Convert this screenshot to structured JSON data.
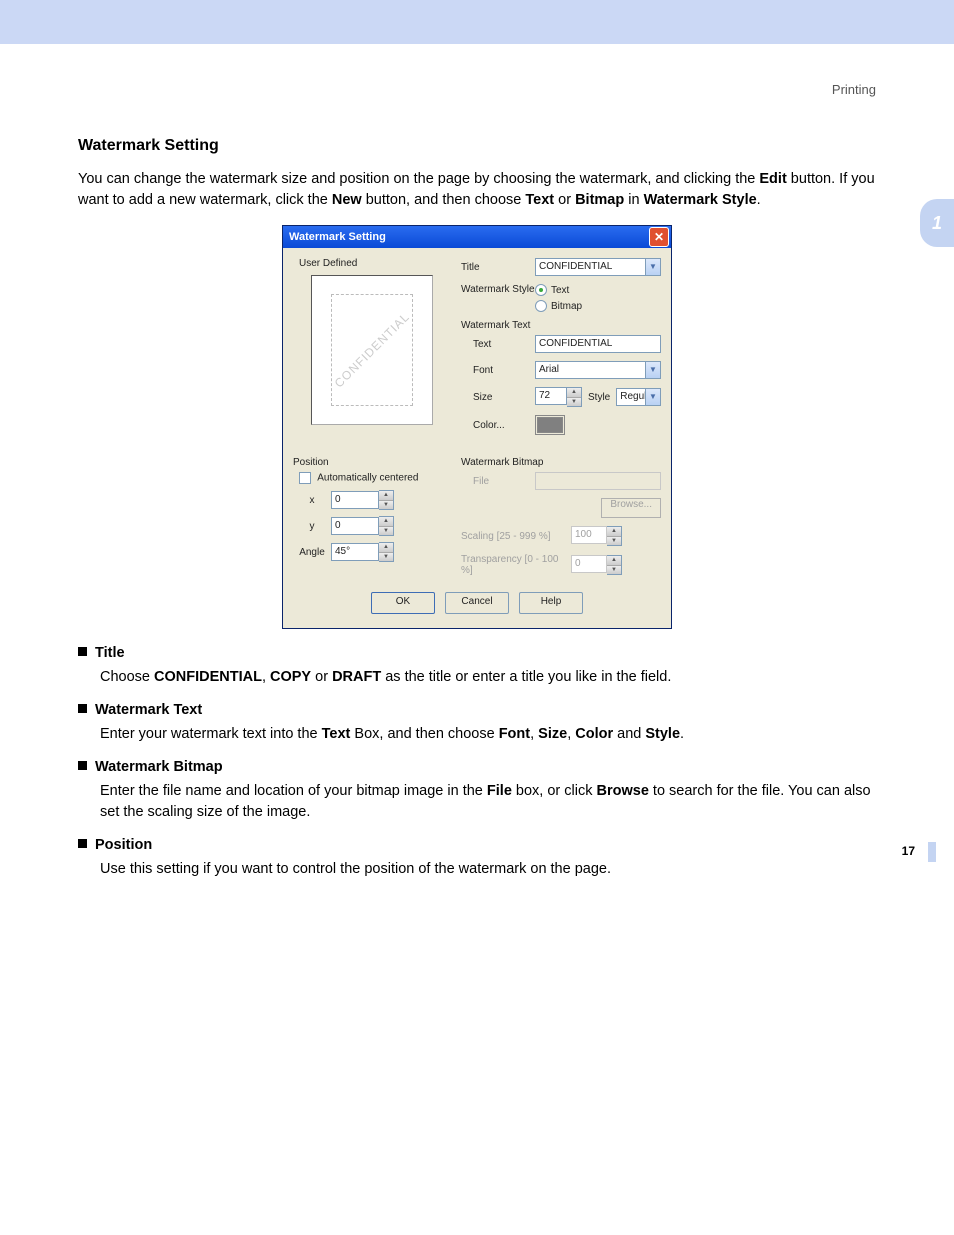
{
  "header": {
    "category": "Printing"
  },
  "section_tab": "1",
  "page_number": "17",
  "heading": "Watermark Setting",
  "intro": {
    "full": "You can change the watermark size and position on the page by choosing the watermark, and clicking the Edit button. If you want to add a new watermark, click the New button, and then choose Text or Bitmap in Watermark Style.",
    "part1": "You can change the watermark size and position on the page by choosing the watermark, and clicking the ",
    "b1": "Edit",
    "part2": " button. If you want to add a new watermark, click the ",
    "b2": "New",
    "part3": " button, and then choose ",
    "b3": "Text",
    "part4": " or ",
    "b4": "Bitmap",
    "part5": " in ",
    "b5": "Watermark Style",
    "part6": "."
  },
  "dialog": {
    "title": "Watermark Setting",
    "user_defined": "User Defined",
    "preview_watermark": "CONFIDENTIAL",
    "labels": {
      "title": "Title",
      "style": "Watermark Style",
      "style_text": "Text",
      "style_bitmap": "Bitmap",
      "wmtext": "Watermark Text",
      "text": "Text",
      "font": "Font",
      "size": "Size",
      "stylef": "Style",
      "color": "Color...",
      "position": "Position",
      "auto_center": "Automatically centered",
      "x": "x",
      "y": "y",
      "angle": "Angle",
      "wmbitmap": "Watermark Bitmap",
      "file": "File",
      "browse": "Browse...",
      "scaling": "Scaling [25 - 999 %]",
      "transparency": "Transparency [0 - 100 %]"
    },
    "values": {
      "title": "CONFIDENTIAL",
      "text": "CONFIDENTIAL",
      "font": "Arial",
      "size": "72",
      "stylef": "Regular",
      "x": "0",
      "y": "0",
      "angle": "45°",
      "scaling": "100",
      "transparency": "0"
    },
    "buttons": {
      "ok": "OK",
      "cancel": "Cancel",
      "help": "Help"
    }
  },
  "bullets": {
    "title": {
      "h": "Title",
      "p1": "Choose ",
      "b1": "CONFIDENTIAL",
      "p2": ", ",
      "b2": "COPY",
      "p3": " or ",
      "b3": "DRAFT",
      "p4": " as the title or enter a title you like in the field."
    },
    "wmtext": {
      "h": "Watermark Text",
      "p1": "Enter your watermark text into the ",
      "b1": "Text",
      "p2": " Box, and then choose ",
      "b2": "Font",
      "p3": ", ",
      "b3": "Size",
      "p4": ", ",
      "b4": "Color",
      "p5": " and ",
      "b5": "Style",
      "p6": "."
    },
    "wmbitmap": {
      "h": "Watermark Bitmap",
      "p1": "Enter the file name and location of your bitmap image in the ",
      "b1": "File",
      "p2": " box, or click ",
      "b2": "Browse",
      "p3": " to search for the file. You can also set the scaling size of the image."
    },
    "position": {
      "h": "Position",
      "p": "Use this setting if you want to control the position of the watermark on the page."
    }
  }
}
